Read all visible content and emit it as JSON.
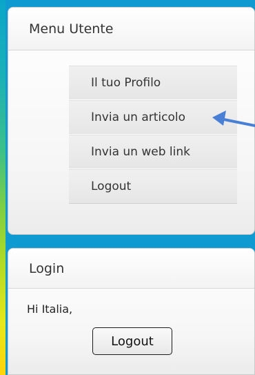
{
  "menu_panel": {
    "title": "Menu Utente",
    "items": [
      {
        "label": "Il tuo Profilo"
      },
      {
        "label": "Invia un articolo"
      },
      {
        "label": "Invia un web link"
      },
      {
        "label": "Logout"
      }
    ]
  },
  "login_panel": {
    "title": "Login",
    "greeting": "Hi Italia,",
    "logout_button": "Logout"
  },
  "annotation": {
    "arrow_color": "#4a7fd6",
    "arrow_icon": "arrow-left-icon",
    "points_to": "Invia un articolo"
  },
  "colors": {
    "background": "#0f9ad1",
    "panel_border": "#c9c9c9",
    "menu_item_bg": "#ececec"
  }
}
